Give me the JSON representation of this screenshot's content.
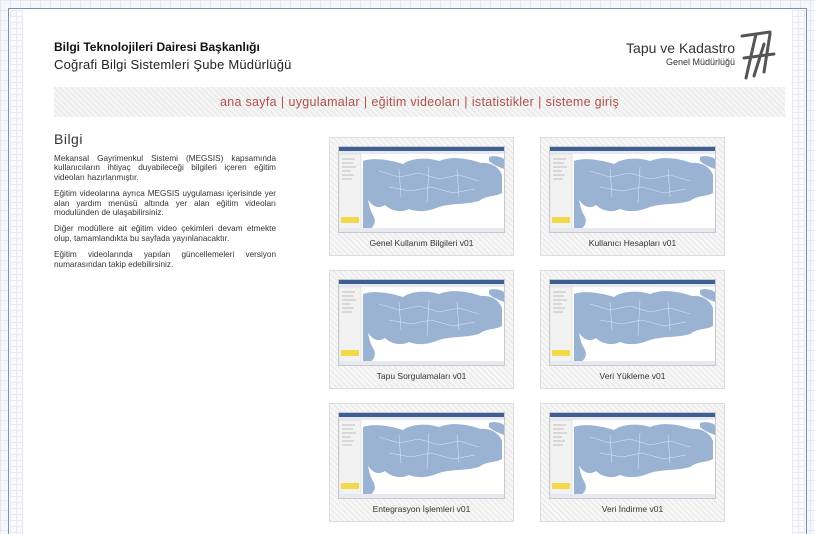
{
  "header": {
    "org_line1": "Bilgi Teknolojileri Dairesi Başkanlığı",
    "org_line2": "Coğrafi Bilgi Sistemleri Şube Müdürlüğü",
    "brand_name": "Tapu ve Kadastro",
    "brand_sub": "Genel Müdürlüğü"
  },
  "nav": {
    "items": [
      "ana sayfa",
      "uygulamalar",
      "eğitim videoları",
      "istatistikler",
      "sisteme giriş"
    ],
    "separator": "|"
  },
  "info": {
    "title": "Bilgi",
    "paragraphs": [
      "Mekansal Gayrimenkul Sistemi (MEGSIS) kapsamında kullanıcıların ihtiyaç duyabileceği bilgileri içeren eğitim videoları hazırlanmıştır.",
      "Eğitim videolarına ayrıca MEGSIS uygulaması içerisinde yer alan yardım menüsü altında yer alan eğitim videoları modulünden de ulaşabilirsiniz.",
      "Diğer modüllere ait eğitim video çekimleri devam etmekte olup, tamamlandıkta bu sayfada yayınlanacaktır.",
      "Eğitim videolarında yapılan güncellemeleri versiyon numarasından takip edebilirsiniz."
    ]
  },
  "videos": [
    {
      "label": "Genel Kullanım Bilgileri v01"
    },
    {
      "label": "Kullanıcı Hesapları v01"
    },
    {
      "label": "Tapu Sorgulamaları v01"
    },
    {
      "label": "Veri Yükleme v01"
    },
    {
      "label": "Entegrasyon İşlemleri v01"
    },
    {
      "label": "Veri İndirme v01"
    }
  ],
  "colors": {
    "nav_text": "#b0504a",
    "map_land": "#9bb3d3",
    "map_sea": "#ffffff",
    "window_border": "#6f8fbf"
  }
}
